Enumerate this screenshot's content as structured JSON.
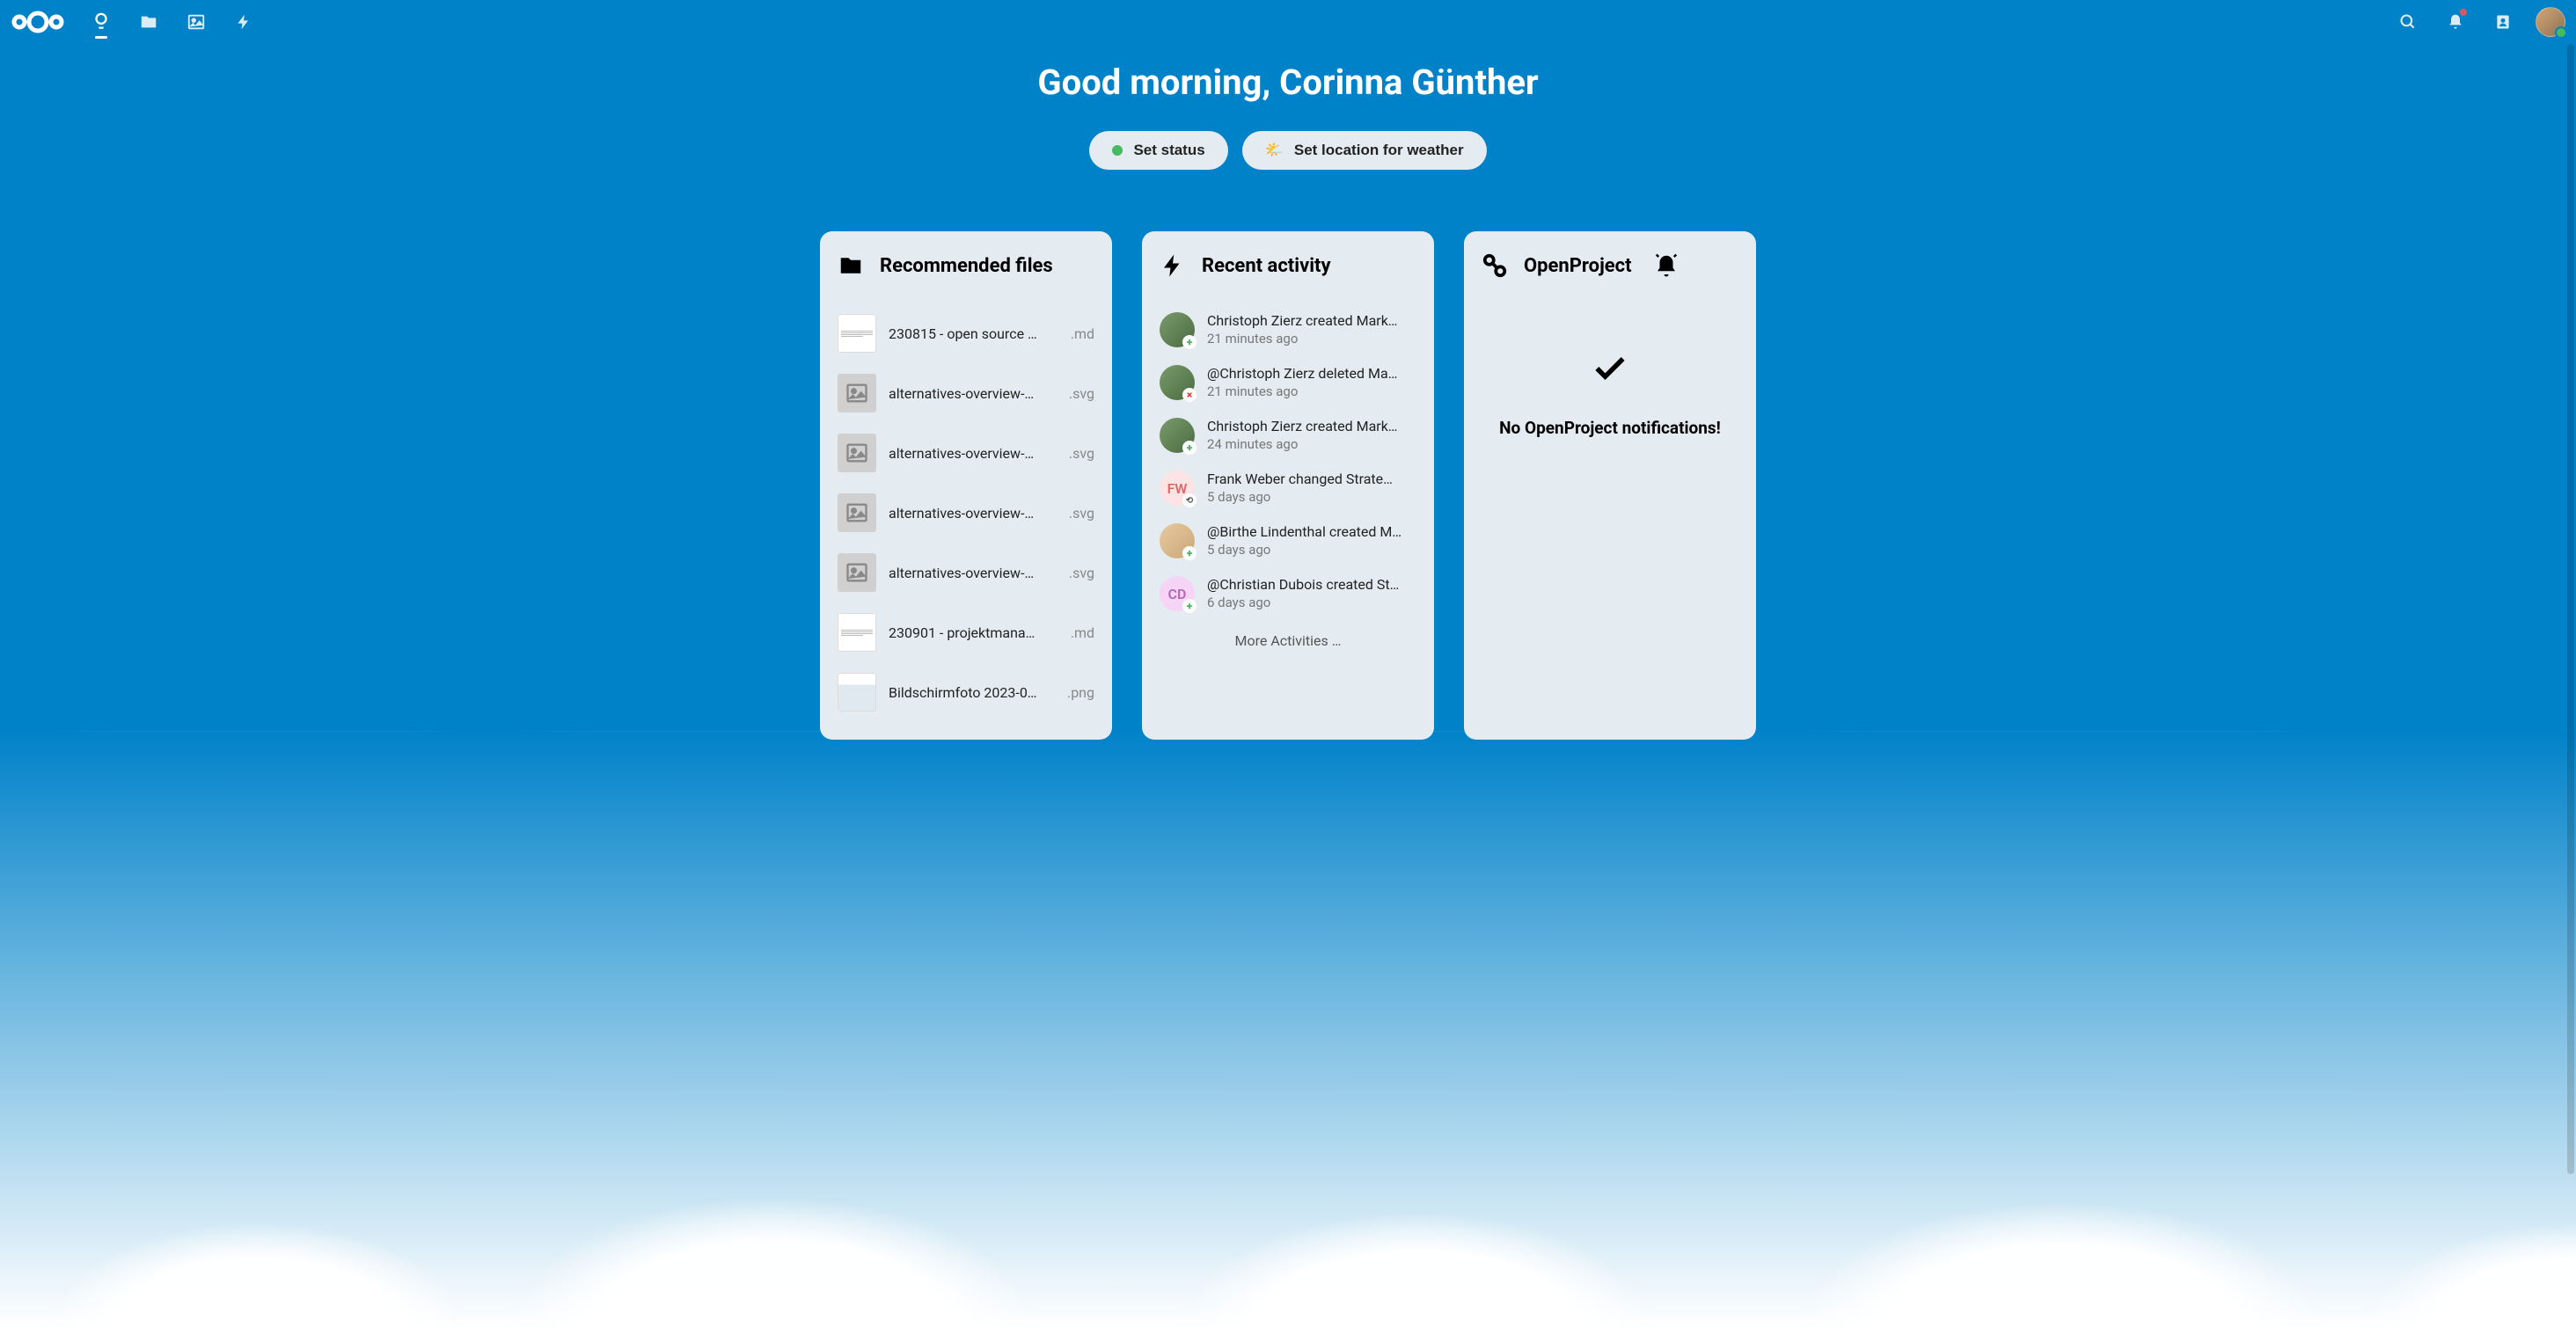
{
  "greeting": "Good morning, Corinna Günther",
  "statusPill": "Set status",
  "weatherPill": "Set location for weather",
  "widgets": {
    "files": {
      "title": "Recommended files",
      "items": [
        {
          "name": "230815 - open source …",
          "ext": ".md",
          "thumb": "doc"
        },
        {
          "name": "alternatives-overview-…",
          "ext": ".svg",
          "thumb": "img"
        },
        {
          "name": "alternatives-overview-…",
          "ext": ".svg",
          "thumb": "img"
        },
        {
          "name": "alternatives-overview-…",
          "ext": ".svg",
          "thumb": "img"
        },
        {
          "name": "alternatives-overview-…",
          "ext": ".svg",
          "thumb": "img"
        },
        {
          "name": "230901 - projektmana…",
          "ext": ".md",
          "thumb": "doc"
        },
        {
          "name": "Bildschirmfoto 2023-0…",
          "ext": ".png",
          "thumb": "screenshot"
        }
      ]
    },
    "activity": {
      "title": "Recent activity",
      "items": [
        {
          "text": "Christoph Zierz created Mark…",
          "time": "21 minutes ago",
          "avatar": "photo1",
          "badge": "add"
        },
        {
          "text": "@Christoph Zierz deleted Ma…",
          "time": "21 minutes ago",
          "avatar": "photo1",
          "badge": "del"
        },
        {
          "text": "Christoph Zierz created Mark…",
          "time": "24 minutes ago",
          "avatar": "photo1",
          "badge": "add"
        },
        {
          "text": "Frank Weber changed Strate…",
          "time": "5 days ago",
          "avatar": "fw",
          "initials": "FW",
          "badge": "chg"
        },
        {
          "text": "@Birthe Lindenthal created M…",
          "time": "5 days ago",
          "avatar": "photo2",
          "badge": "add"
        },
        {
          "text": "@Christian Dubois created St…",
          "time": "6 days ago",
          "avatar": "cd",
          "initials": "CD",
          "badge": "add"
        }
      ],
      "more": "More Activities …"
    },
    "openproject": {
      "title": "OpenProject",
      "emptyText": "No OpenProject notifications!"
    }
  }
}
